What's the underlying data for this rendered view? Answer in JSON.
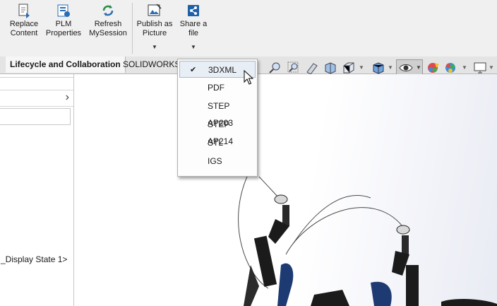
{
  "ribbon": {
    "buttons": [
      {
        "label": "Replace\nContent",
        "icon": "replace-content-icon"
      },
      {
        "label": "PLM\nProperties",
        "icon": "plm-properties-icon"
      },
      {
        "label": "Refresh\nMySession",
        "icon": "refresh-icon"
      },
      {
        "label": "Publish as\nPicture",
        "icon": "publish-picture-icon"
      },
      {
        "label": "Share a\nfile",
        "icon": "share-file-icon"
      }
    ]
  },
  "tabs": [
    {
      "label": "Lifecycle and Collaboration"
    },
    {
      "label": "SOLIDWORKS"
    }
  ],
  "left_pane": {
    "display_state": "_Display State 1>"
  },
  "share_menu": {
    "items": [
      {
        "label": "3DXML",
        "checked": true
      },
      {
        "label": "PDF",
        "checked": false
      },
      {
        "label": "STEP AP203",
        "checked": false
      },
      {
        "label": "STEP AP214",
        "checked": false
      },
      {
        "label": "STL",
        "checked": false
      },
      {
        "label": "IGS",
        "checked": false
      }
    ],
    "check_glyph": "✔"
  },
  "colors": {
    "accent": "#2a6db5",
    "model_dark": "#1b1b1b",
    "model_blue": "#1e3a72"
  }
}
